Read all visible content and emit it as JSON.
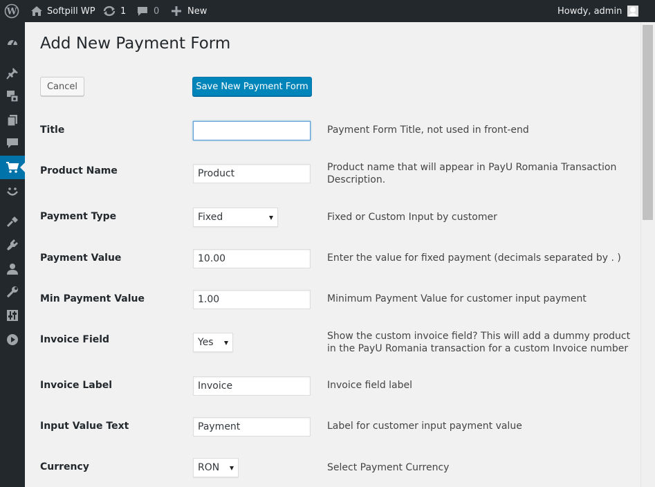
{
  "adminbar": {
    "site_name": "Softpill WP",
    "updates_count": "1",
    "comments_count": "0",
    "new_label": "New",
    "howdy": "Howdy, admin"
  },
  "sidebar": {
    "items": [
      "dashboard-icon",
      "pin-icon",
      "media-icon",
      "pages-icon",
      "comments-icon",
      "cart-icon",
      "smile-icon",
      "appearance-icon",
      "plugins-icon",
      "users-icon",
      "tools-icon",
      "settings-icon",
      "play-icon"
    ],
    "current": "cart-icon"
  },
  "page": {
    "title": "Add New Payment Form",
    "cancel_label": "Cancel",
    "save_label": "Save New Payment Form"
  },
  "form": {
    "title": {
      "label": "Title",
      "value": "",
      "desc": "Payment Form Title, not used in front-end"
    },
    "product_name": {
      "label": "Product Name",
      "value": "Product",
      "desc": "Product name that will appear in PayU Romania Transaction Description."
    },
    "payment_type": {
      "label": "Payment Type",
      "value": "Fixed",
      "desc": "Fixed or Custom Input by customer"
    },
    "payment_value": {
      "label": "Payment Value",
      "value": "10.00",
      "desc": "Enter the value for fixed payment (decimals separated by . )"
    },
    "min_payment_value": {
      "label": "Min Payment Value",
      "value": "1.00",
      "desc": "Minimum Payment Value for customer input payment"
    },
    "invoice_field": {
      "label": "Invoice Field",
      "value": "Yes",
      "desc": "Show the custom invoice field? This will add a dummy product in the PayU Romania transaction for a custom Invoice number"
    },
    "invoice_label": {
      "label": "Invoice Label",
      "value": "Invoice",
      "desc": "Invoice field label"
    },
    "input_value_text": {
      "label": "Input Value Text",
      "value": "Payment",
      "desc": "Label for customer input payment value"
    },
    "currency": {
      "label": "Currency",
      "value": "RON",
      "desc": "Select Payment Currency"
    }
  },
  "colors": {
    "adminbar_bg": "#23282d",
    "accent": "#0073aa",
    "primary_button": "#0085ba",
    "page_bg": "#f1f1f1"
  }
}
